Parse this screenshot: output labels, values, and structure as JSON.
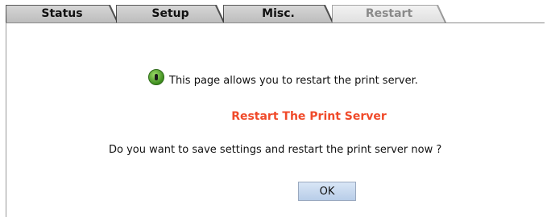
{
  "tabs": [
    {
      "label": "Status",
      "state": "inactive"
    },
    {
      "label": "Setup",
      "state": "inactive"
    },
    {
      "label": "Misc.",
      "state": "inactive"
    },
    {
      "label": "Restart",
      "state": "active"
    }
  ],
  "content": {
    "info_icon": "info-icon",
    "info_text": "This page allows you to restart the print server.",
    "heading": "Restart The Print Server",
    "question": "Do you want to save settings and restart the print server now ?",
    "ok_label": "OK"
  },
  "colors": {
    "heading": "#f04a2a",
    "button": "#c6d8ee"
  }
}
